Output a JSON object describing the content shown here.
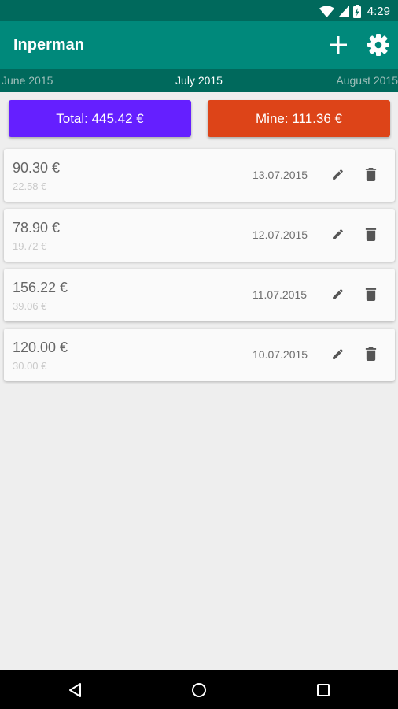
{
  "status_bar": {
    "time": "4:29",
    "icons": [
      "wifi-icon",
      "cellular-signal-icon",
      "battery-charging-icon"
    ]
  },
  "app_bar": {
    "title": "Inperman",
    "actions": [
      "add-icon",
      "settings-gear-icon"
    ]
  },
  "month_nav": {
    "previous": "June 2015",
    "current": "July 2015",
    "next": "August 2015"
  },
  "summary": {
    "total_label": "Total: 445.42 €",
    "mine_label": "Mine: 111.36 €",
    "total_color": "#651FFF",
    "mine_color": "#DD4418"
  },
  "expenses": [
    {
      "amount": "90.30 €",
      "share": "22.58 €",
      "date": "13.07.2015"
    },
    {
      "amount": "78.90 €",
      "share": "19.72 €",
      "date": "12.07.2015"
    },
    {
      "amount": "156.22 €",
      "share": "39.06 €",
      "date": "11.07.2015"
    },
    {
      "amount": "120.00 €",
      "share": "30.00 €",
      "date": "10.07.2015"
    }
  ],
  "row_actions": [
    "edit-pencil-icon",
    "delete-trash-icon"
  ],
  "nav_bar": [
    "back-icon",
    "home-icon",
    "recents-icon"
  ],
  "colors": {
    "primary": "#00897B",
    "primary_dark": "#00695C",
    "background": "#EEEEEE"
  }
}
